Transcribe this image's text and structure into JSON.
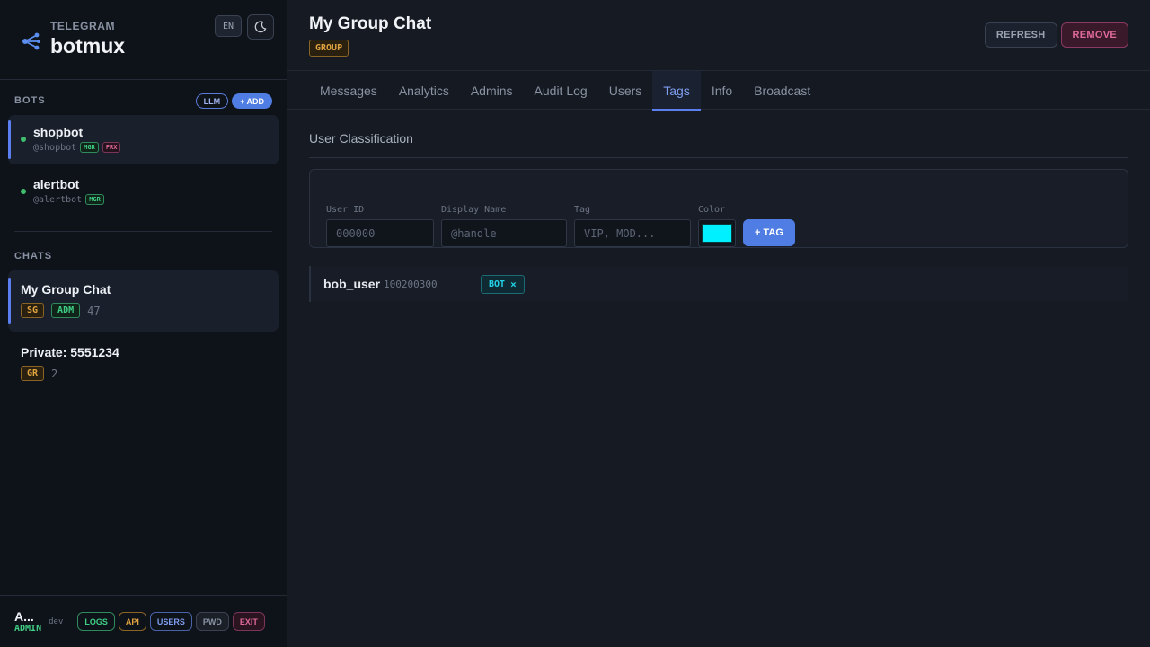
{
  "brand": {
    "subtitle": "TELEGRAM",
    "title": "botmux",
    "lang": "EN",
    "theme_icon": "moon-icon",
    "logo_icon": "share-nodes-icon"
  },
  "bots": {
    "section_label": "BOTS",
    "llm_label": "LLM",
    "add_label": "+ ADD",
    "items": [
      {
        "name": "shopbot",
        "handle": "@shopbot",
        "badges": [
          "MGR",
          "PRX"
        ]
      },
      {
        "name": "alertbot",
        "handle": "@alertbot",
        "badges": [
          "MGR"
        ]
      }
    ]
  },
  "chats": {
    "section_label": "CHATS",
    "items": [
      {
        "name": "My Group Chat",
        "tags": [
          "SG",
          "ADM"
        ],
        "count": "47"
      },
      {
        "name": "Private: 5551234",
        "tags": [
          "GR"
        ],
        "count": "2"
      }
    ]
  },
  "footer": {
    "user": "A...",
    "role": "ADMIN",
    "env": "dev",
    "buttons": {
      "logs": "LOGS",
      "api": "API",
      "users": "USERS",
      "pwd": "PWD",
      "exit": "EXIT"
    }
  },
  "header": {
    "title": "My Group Chat",
    "badge": "GROUP",
    "refresh": "REFRESH",
    "remove": "REMOVE"
  },
  "tabs": [
    "Messages",
    "Analytics",
    "Admins",
    "Audit Log",
    "Users",
    "Tags",
    "Info",
    "Broadcast"
  ],
  "active_tab": "Tags",
  "classification": {
    "title": "User Classification",
    "fields": {
      "user_id": {
        "label": "User ID",
        "placeholder": "000000"
      },
      "display_name": {
        "label": "Display Name",
        "placeholder": "@handle"
      },
      "tag": {
        "label": "Tag",
        "placeholder": "VIP, MOD..."
      },
      "color": {
        "label": "Color",
        "value": "#00f0ff"
      }
    },
    "add_button": "+ TAG",
    "rows": [
      {
        "user": "bob_user",
        "id": "100200300",
        "tag": "BOT",
        "remove": "×"
      }
    ]
  },
  "colors": {
    "accent": "#4f7de3",
    "online": "#3fbf6d",
    "tag_cyan": "#22d3e6"
  }
}
